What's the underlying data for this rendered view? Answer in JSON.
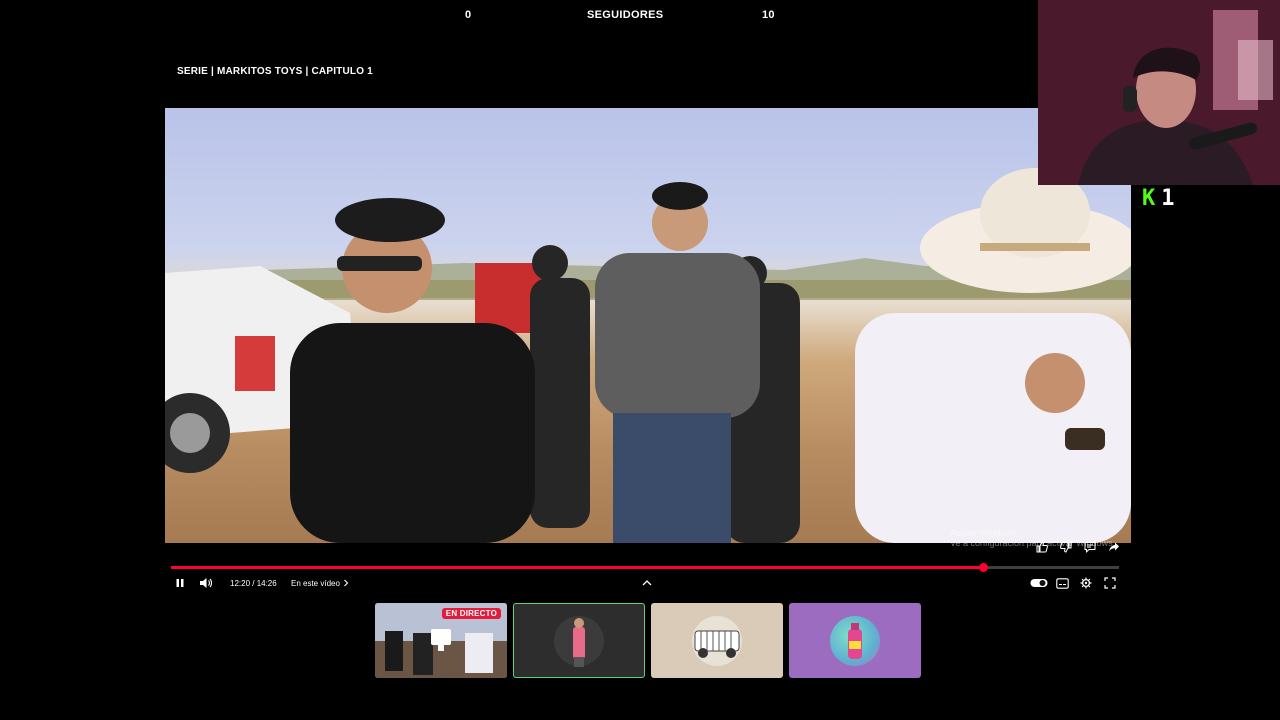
{
  "overlay": {
    "counter_left": "0",
    "counter_center": "SEGUIDORES",
    "counter_right": "10"
  },
  "video": {
    "title": "SERIE | MARKITOS TOYS | CAPITULO 1",
    "watermark_line1": "Activar Windows",
    "watermark_line2": "Ve a configuración para activar Windows."
  },
  "kick": {
    "logo": "K",
    "count": "1",
    "brand_color": "#53fc18"
  },
  "player": {
    "time": "12:20 / 14:26",
    "chapter_label": "En este vídeo",
    "progress": 0.857,
    "accent_color": "#ff0033",
    "icons": {
      "play_pause": "pause-icon",
      "volume": "volume-icon",
      "chapter_arrow": "chevron-right-icon",
      "expand": "chevron-up-icon",
      "autoplay": "toggle-icon",
      "subtitles": "subtitles-icon",
      "settings": "gear-icon",
      "fullscreen": "fullscreen-icon"
    }
  },
  "video_actions": [
    "like-icon",
    "dislike-icon",
    "comment-icon",
    "share-icon"
  ],
  "thumbnails": [
    {
      "badge": "EN DIRECTO",
      "kind": "live"
    },
    {
      "badge": "",
      "kind": "selected"
    },
    {
      "badge": "",
      "kind": "beige"
    },
    {
      "badge": "",
      "kind": "purple"
    }
  ]
}
